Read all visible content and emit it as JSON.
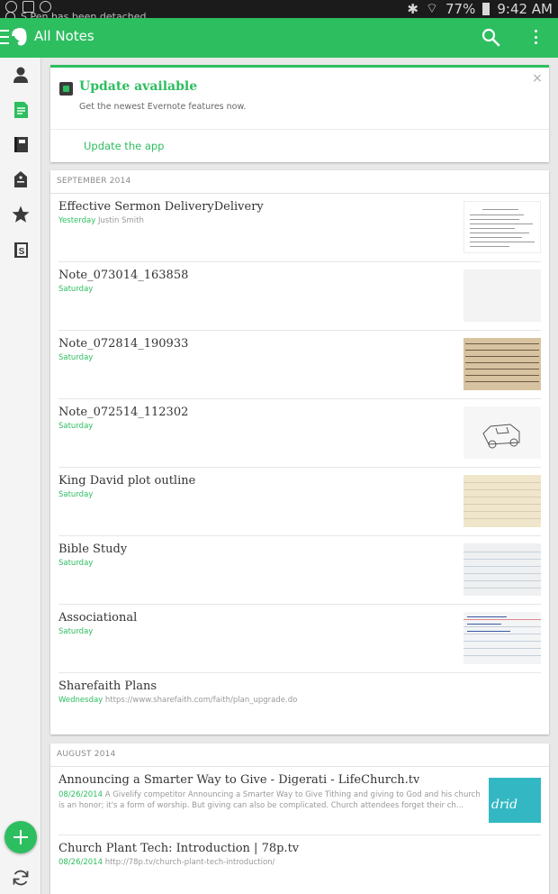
{
  "status_bar": {
    "notification": "S Pen has been detached",
    "battery": "77%",
    "time": "9:42 AM"
  },
  "app_bar": {
    "title": "All Notes",
    "icons": [
      "menu-icon",
      "evernote-logo-icon",
      "search-icon",
      "more-vert-icon"
    ],
    "color": "#2dbe60"
  },
  "sidebar": {
    "items": [
      "account-icon",
      "notes-icon",
      "notebooks-icon",
      "tags-icon",
      "shortcuts-icon",
      "work-chat-icon"
    ],
    "fab_icon": "plus-icon",
    "sync_icon": "sync-icon"
  },
  "banner": {
    "title": "Update available",
    "subtitle": "Get the newest Evernote features now.",
    "action": "Update the app",
    "close": "×"
  },
  "sections": [
    {
      "header": "SEPTEMBER 2014",
      "notes": [
        {
          "title": "Effective Sermon DeliveryDelivery",
          "date": "Yesterday",
          "meta": "Justin Smith",
          "thumb": "document"
        },
        {
          "title": "Note_073014_163858",
          "date": "Saturday",
          "meta": "",
          "thumb": "blank"
        },
        {
          "title": "Note_072814_190933",
          "date": "Saturday",
          "meta": "",
          "thumb": "handwriting"
        },
        {
          "title": "Note_072514_112302",
          "date": "Saturday",
          "meta": "",
          "thumb": "sketch"
        },
        {
          "title": "King David plot outline",
          "date": "Saturday",
          "meta": "",
          "thumb": "yellow-lined"
        },
        {
          "title": "Bible Study",
          "date": "Saturday",
          "meta": "",
          "thumb": "lined"
        },
        {
          "title": "Associational",
          "date": "Saturday",
          "meta": "",
          "thumb": "notecard"
        },
        {
          "title": "Sharefaith Plans",
          "date": "Wednesday",
          "meta": "https://www.sharefaith.com/faith/plan_upgrade.do",
          "thumb": "none"
        }
      ]
    },
    {
      "header": "AUGUST 2014",
      "notes": [
        {
          "title": "Announcing a Smarter Way to Give - Digerati - LifeChurch.tv",
          "date": "08/26/2014",
          "meta": "A Givelify competitor Announcing a Smarter Way to Give Tithing and giving to God and his church is an honor; it's a form of worship. But giving can also be complicated. Church attendees forget their ch...",
          "thumb": "teal",
          "thumb_text": "drid"
        },
        {
          "title": "Church Plant Tech: Introduction | 78p.tv",
          "date": "08/26/2014",
          "meta": "http://78p.tv/church-plant-tech-introduction/",
          "thumb": "none"
        }
      ]
    }
  ]
}
